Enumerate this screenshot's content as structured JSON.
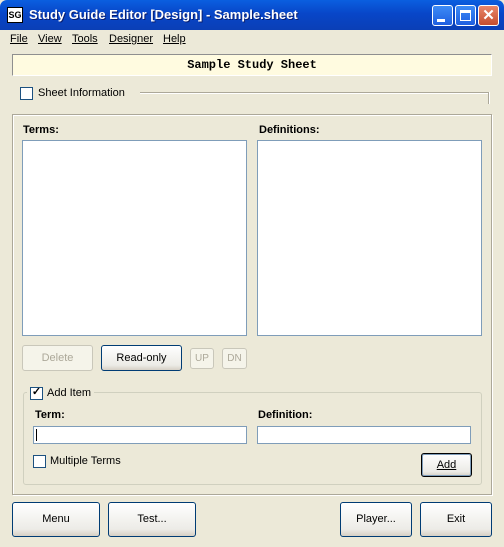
{
  "window": {
    "title": "Study Guide Editor [Design] - Sample.sheet",
    "icon_label": "SG"
  },
  "menu": [
    "File",
    "View",
    "Tools",
    "Designer",
    "Help"
  ],
  "banner": {
    "text": "Sample Study Sheet"
  },
  "sheet_info": {
    "label": "Sheet Information",
    "checked": false
  },
  "lists": {
    "terms_label": "Terms:",
    "definitions_label": "Definitions:",
    "terms": [],
    "definitions": []
  },
  "list_buttons": {
    "delete": "Delete",
    "readonly": "Read-only",
    "up": "UP",
    "down": "DN"
  },
  "add_item": {
    "label": "Add Item",
    "checked": true,
    "term_label": "Term:",
    "definition_label": "Definition:",
    "term_value": "",
    "definition_value": "",
    "multiple_terms_label": "Multiple Terms",
    "multiple_terms_checked": false,
    "add_button": "Add"
  },
  "footer": {
    "menu": "Menu",
    "test": "Test...",
    "player": "Player...",
    "exit": "Exit"
  }
}
